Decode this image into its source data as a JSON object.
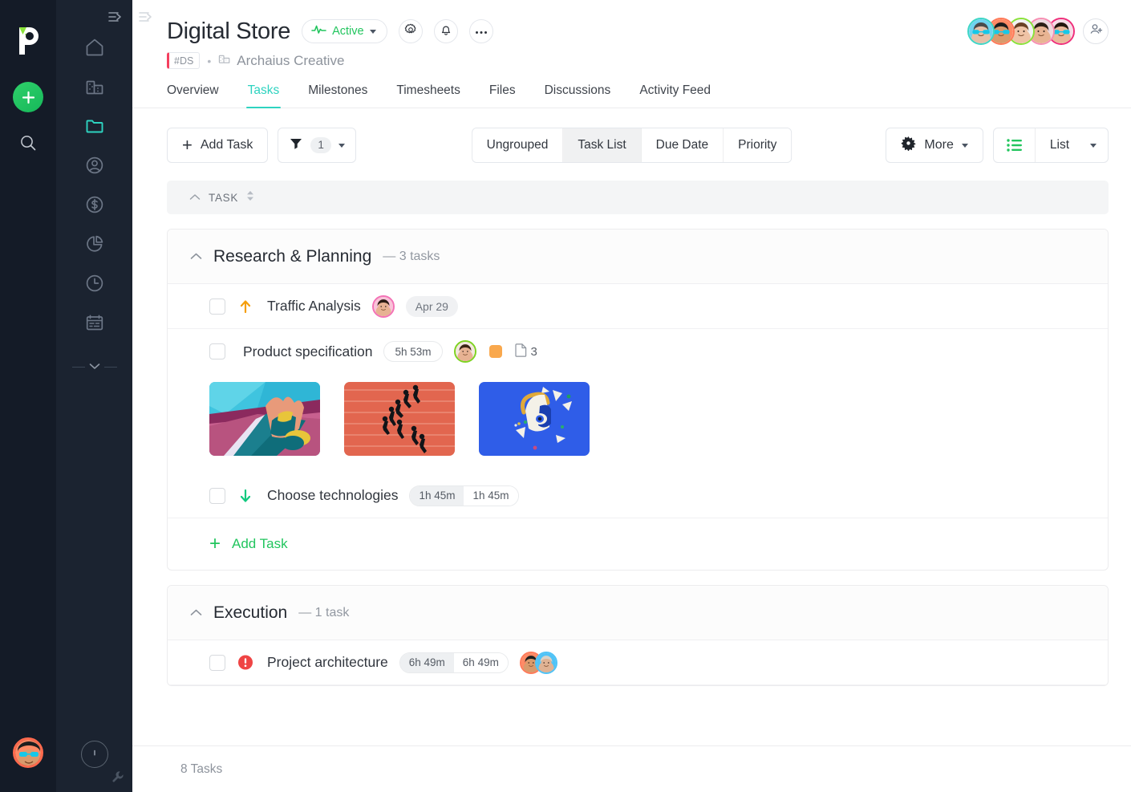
{
  "rail": {
    "logo_name": "paymo-logo",
    "add_label": "+",
    "search_icon": "search-icon",
    "user_avatar": "user-avatar",
    "collapse_icon": "collapse-sidebar-icon",
    "nav_items": [
      {
        "icon": "home-icon",
        "name": "dashboard",
        "active": false
      },
      {
        "icon": "building-icon",
        "name": "company",
        "active": false
      },
      {
        "icon": "folder-icon",
        "name": "projects",
        "active": true
      },
      {
        "icon": "user-circle-icon",
        "name": "people",
        "active": false
      },
      {
        "icon": "dollar-circle-icon",
        "name": "invoices",
        "active": false
      },
      {
        "icon": "pie-chart-icon",
        "name": "reports",
        "active": false
      },
      {
        "icon": "clock-icon",
        "name": "timesheets",
        "active": false
      },
      {
        "icon": "calendar-icon",
        "name": "scheduling",
        "active": false
      }
    ],
    "more_icon": "chevron-down-icon",
    "info_icon": "info-icon",
    "wrench_icon": "wrench-icon"
  },
  "header": {
    "title": "Digital Store",
    "status": {
      "label": "Active",
      "color": "#22c55e",
      "icon": "activity-pulse-icon"
    },
    "settings_icon": "gear-icon",
    "notifications_icon": "bell-icon",
    "more_icon": "ellipsis-icon",
    "project_code": "#DS",
    "separator": "•",
    "organization": "Archaius Creative",
    "org_icon": "building-icon",
    "code_accent": "#f43f5e",
    "members": [
      {
        "name": "member-1",
        "ring": "#3ed6c6",
        "skin": "#e6c0a8",
        "hair": "#4b4b4b",
        "bg": "#6fd3ef",
        "glasses": true,
        "beard": true
      },
      {
        "name": "member-2",
        "ring": "#ff7a59",
        "skin": "#d99a6c",
        "hair": "#1e1e1e",
        "bg": "#ff8a65",
        "glasses": true,
        "beard": false
      },
      {
        "name": "member-3",
        "ring": "#8ae23a",
        "skin": "#efc3a6",
        "hair": "#6b4226",
        "bg": "#f2f2f2",
        "glasses": false,
        "beard": false
      },
      {
        "name": "member-4",
        "ring": "#f78fb3",
        "skin": "#e8b493",
        "hair": "#2d2016",
        "bg": "#efd9df",
        "glasses": false,
        "beard": false
      },
      {
        "name": "member-5",
        "ring": "#ef2f7b",
        "skin": "#eab89a",
        "hair": "#23170f",
        "bg": "#f7dce7",
        "glasses": true,
        "beard": false
      }
    ],
    "add_member_icon": "add-person-icon"
  },
  "tabs": [
    {
      "label": "Overview",
      "active": false
    },
    {
      "label": "Tasks",
      "active": true
    },
    {
      "label": "Milestones",
      "active": false
    },
    {
      "label": "Timesheets",
      "active": false
    },
    {
      "label": "Files",
      "active": false
    },
    {
      "label": "Discussions",
      "active": false
    },
    {
      "label": "Activity Feed",
      "active": false
    }
  ],
  "toolbar": {
    "add_task_label": "Add Task",
    "filter_icon": "filter-icon",
    "filter_count": "1",
    "group_options": [
      {
        "label": "Ungrouped",
        "active": false
      },
      {
        "label": "Task List",
        "active": true
      },
      {
        "label": "Due Date",
        "active": false
      },
      {
        "label": "Priority",
        "active": false
      }
    ],
    "more_label": "More",
    "more_icon": "gear-star-icon",
    "view_icon": "list-view-icon",
    "view_label": "List",
    "accent_green": "#22c55e"
  },
  "table": {
    "column_header": "TASK",
    "sort_icon": "sort-updown-icon",
    "collapse_icon": "chevron-up-icon"
  },
  "groups": [
    {
      "title": "Research & Planning",
      "count_label": "— 3 tasks",
      "add_task_label": "Add Task",
      "tasks": [
        {
          "name": "Traffic Analysis",
          "priority": "high",
          "priority_icon": "arrow-up-icon",
          "priority_color": "#f59e0b",
          "date": "Apr 29",
          "assignees": [
            {
              "name": "assignee-1",
              "ring": "#f472b6",
              "skin": "#e7b293",
              "hair": "#2b1c14",
              "bg": "#f9c3d8"
            }
          ],
          "times": [],
          "tag_color": null,
          "files": null,
          "thumbnails": []
        },
        {
          "name": "Product specification",
          "priority": null,
          "priority_icon": null,
          "priority_color": null,
          "date": null,
          "assignees": [
            {
              "name": "assignee-2",
              "ring": "#7ed321",
              "skin": "#e7b293",
              "hair": "#3b2414",
              "bg": "#f4e7de"
            }
          ],
          "times": [
            "5h 53m"
          ],
          "tag_color": "#f9a84d",
          "files": "3",
          "thumbnails": [
            {
              "name": "thumbnail-hands-artwork"
            },
            {
              "name": "thumbnail-running-track"
            },
            {
              "name": "thumbnail-blue-sculpture"
            }
          ]
        },
        {
          "name": "Choose technologies",
          "priority": "low",
          "priority_icon": "arrow-down-icon",
          "priority_color": "#10c97f",
          "date": null,
          "assignees": [],
          "times": [
            "1h 45m",
            "1h 45m"
          ],
          "tag_color": null,
          "files": null,
          "thumbnails": []
        }
      ]
    },
    {
      "title": "Execution",
      "count_label": "— 1 task",
      "add_task_label": "Add Task",
      "tasks": [
        {
          "name": "Project architecture",
          "priority": "urgent",
          "priority_icon": "exclamation-circle-icon",
          "priority_color": "#ef4444",
          "date": null,
          "assignees": [
            {
              "name": "assignee-3",
              "ring": "#ff7a59",
              "skin": "#d99a6c",
              "hair": "#1e1e1e",
              "bg": "#ff8a65"
            },
            {
              "name": "assignee-4",
              "ring": "#4fc3f7",
              "skin": "#e0b293",
              "hair": "#d8d2c8",
              "bg": "#4fc3f7"
            }
          ],
          "times": [
            "6h 49m",
            "6h 49m"
          ],
          "tag_color": null,
          "files": null,
          "thumbnails": []
        }
      ]
    }
  ],
  "footer": {
    "task_count": "8 Tasks"
  }
}
